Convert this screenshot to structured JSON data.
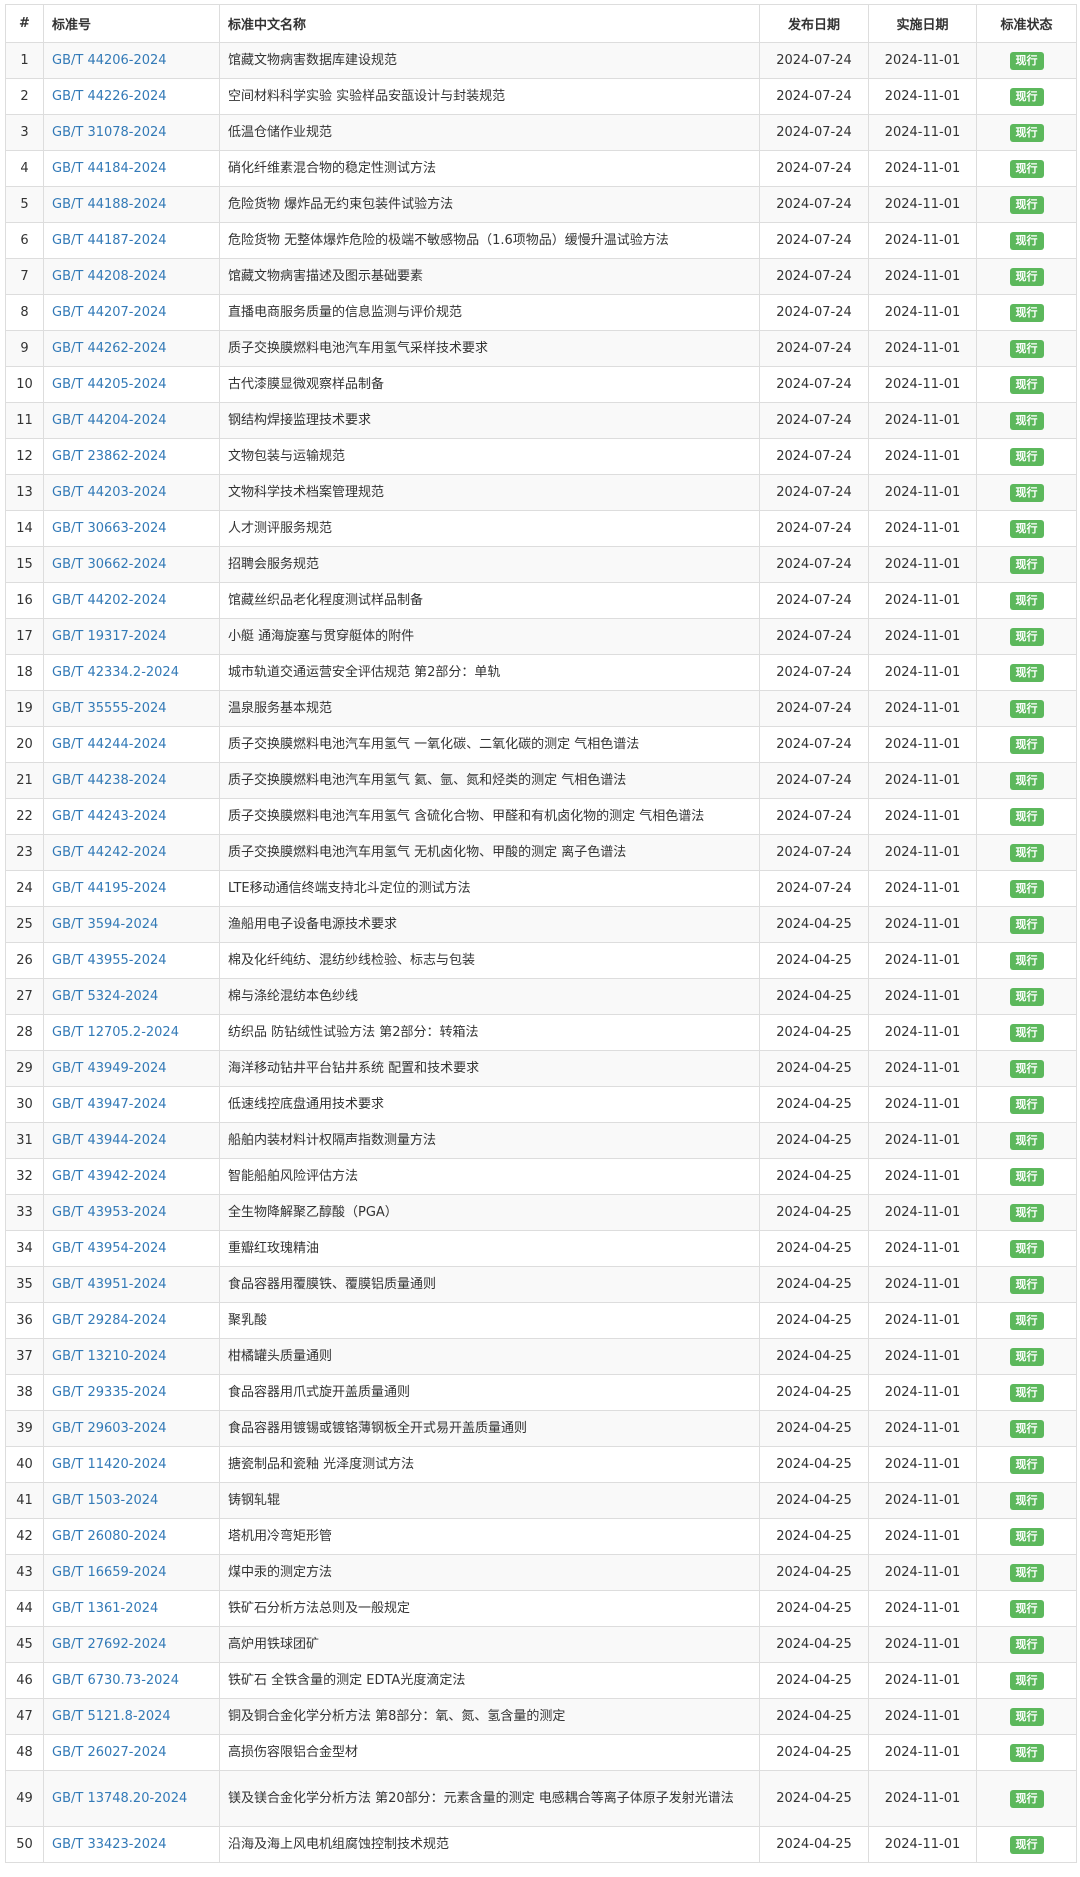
{
  "header": {
    "index": "#",
    "code": "标准号",
    "name": "标准中文名称",
    "published": "发布日期",
    "effective": "实施日期",
    "status": "标准状态"
  },
  "rows": [
    {
      "n": "1",
      "code": "GB/T 44206-2024",
      "name": "馆藏文物病害数据库建设规范",
      "pub": "2024-07-24",
      "eff": "2024-11-01",
      "status": "现行"
    },
    {
      "n": "2",
      "code": "GB/T 44226-2024",
      "name": "空间材料科学实验 实验样品安瓿设计与封装规范",
      "pub": "2024-07-24",
      "eff": "2024-11-01",
      "status": "现行"
    },
    {
      "n": "3",
      "code": "GB/T 31078-2024",
      "name": "低温仓储作业规范",
      "pub": "2024-07-24",
      "eff": "2024-11-01",
      "status": "现行"
    },
    {
      "n": "4",
      "code": "GB/T 44184-2024",
      "name": "硝化纤维素混合物的稳定性测试方法",
      "pub": "2024-07-24",
      "eff": "2024-11-01",
      "status": "现行"
    },
    {
      "n": "5",
      "code": "GB/T 44188-2024",
      "name": "危险货物 爆炸品无约束包装件试验方法",
      "pub": "2024-07-24",
      "eff": "2024-11-01",
      "status": "现行"
    },
    {
      "n": "6",
      "code": "GB/T 44187-2024",
      "name": "危险货物 无整体爆炸危险的极端不敏感物品（1.6项物品）缓慢升温试验方法",
      "pub": "2024-07-24",
      "eff": "2024-11-01",
      "status": "现行"
    },
    {
      "n": "7",
      "code": "GB/T 44208-2024",
      "name": "馆藏文物病害描述及图示基础要素",
      "pub": "2024-07-24",
      "eff": "2024-11-01",
      "status": "现行"
    },
    {
      "n": "8",
      "code": "GB/T 44207-2024",
      "name": "直播电商服务质量的信息监测与评价规范",
      "pub": "2024-07-24",
      "eff": "2024-11-01",
      "status": "现行"
    },
    {
      "n": "9",
      "code": "GB/T 44262-2024",
      "name": "质子交换膜燃料电池汽车用氢气采样技术要求",
      "pub": "2024-07-24",
      "eff": "2024-11-01",
      "status": "现行"
    },
    {
      "n": "10",
      "code": "GB/T 44205-2024",
      "name": "古代漆膜显微观察样品制备",
      "pub": "2024-07-24",
      "eff": "2024-11-01",
      "status": "现行"
    },
    {
      "n": "11",
      "code": "GB/T 44204-2024",
      "name": "钢结构焊接监理技术要求",
      "pub": "2024-07-24",
      "eff": "2024-11-01",
      "status": "现行"
    },
    {
      "n": "12",
      "code": "GB/T 23862-2024",
      "name": "文物包装与运输规范",
      "pub": "2024-07-24",
      "eff": "2024-11-01",
      "status": "现行"
    },
    {
      "n": "13",
      "code": "GB/T 44203-2024",
      "name": "文物科学技术档案管理规范",
      "pub": "2024-07-24",
      "eff": "2024-11-01",
      "status": "现行"
    },
    {
      "n": "14",
      "code": "GB/T 30663-2024",
      "name": "人才测评服务规范",
      "pub": "2024-07-24",
      "eff": "2024-11-01",
      "status": "现行"
    },
    {
      "n": "15",
      "code": "GB/T 30662-2024",
      "name": "招聘会服务规范",
      "pub": "2024-07-24",
      "eff": "2024-11-01",
      "status": "现行"
    },
    {
      "n": "16",
      "code": "GB/T 44202-2024",
      "name": "馆藏丝织品老化程度测试样品制备",
      "pub": "2024-07-24",
      "eff": "2024-11-01",
      "status": "现行"
    },
    {
      "n": "17",
      "code": "GB/T 19317-2024",
      "name": "小艇 通海旋塞与贯穿艇体的附件",
      "pub": "2024-07-24",
      "eff": "2024-11-01",
      "status": "现行"
    },
    {
      "n": "18",
      "code": "GB/T 42334.2-2024",
      "name": "城市轨道交通运营安全评估规范 第2部分：单轨",
      "pub": "2024-07-24",
      "eff": "2024-11-01",
      "status": "现行"
    },
    {
      "n": "19",
      "code": "GB/T 35555-2024",
      "name": "温泉服务基本规范",
      "pub": "2024-07-24",
      "eff": "2024-11-01",
      "status": "现行"
    },
    {
      "n": "20",
      "code": "GB/T 44244-2024",
      "name": "质子交换膜燃料电池汽车用氢气 一氧化碳、二氧化碳的测定 气相色谱法",
      "pub": "2024-07-24",
      "eff": "2024-11-01",
      "status": "现行"
    },
    {
      "n": "21",
      "code": "GB/T 44238-2024",
      "name": "质子交换膜燃料电池汽车用氢气 氦、氩、氮和烃类的测定 气相色谱法",
      "pub": "2024-07-24",
      "eff": "2024-11-01",
      "status": "现行"
    },
    {
      "n": "22",
      "code": "GB/T 44243-2024",
      "name": "质子交换膜燃料电池汽车用氢气 含硫化合物、甲醛和有机卤化物的测定 气相色谱法",
      "pub": "2024-07-24",
      "eff": "2024-11-01",
      "status": "现行"
    },
    {
      "n": "23",
      "code": "GB/T 44242-2024",
      "name": "质子交换膜燃料电池汽车用氢气 无机卤化物、甲酸的测定 离子色谱法",
      "pub": "2024-07-24",
      "eff": "2024-11-01",
      "status": "现行"
    },
    {
      "n": "24",
      "code": "GB/T 44195-2024",
      "name": "LTE移动通信终端支持北斗定位的测试方法",
      "pub": "2024-07-24",
      "eff": "2024-11-01",
      "status": "现行"
    },
    {
      "n": "25",
      "code": "GB/T 3594-2024",
      "name": "渔船用电子设备电源技术要求",
      "pub": "2024-04-25",
      "eff": "2024-11-01",
      "status": "现行"
    },
    {
      "n": "26",
      "code": "GB/T 43955-2024",
      "name": "棉及化纤纯纺、混纺纱线检验、标志与包装",
      "pub": "2024-04-25",
      "eff": "2024-11-01",
      "status": "现行"
    },
    {
      "n": "27",
      "code": "GB/T 5324-2024",
      "name": "棉与涤纶混纺本色纱线",
      "pub": "2024-04-25",
      "eff": "2024-11-01",
      "status": "现行"
    },
    {
      "n": "28",
      "code": "GB/T 12705.2-2024",
      "name": "纺织品 防钻绒性试验方法 第2部分：转箱法",
      "pub": "2024-04-25",
      "eff": "2024-11-01",
      "status": "现行"
    },
    {
      "n": "29",
      "code": "GB/T 43949-2024",
      "name": "海洋移动钻井平台钻井系统 配置和技术要求",
      "pub": "2024-04-25",
      "eff": "2024-11-01",
      "status": "现行"
    },
    {
      "n": "30",
      "code": "GB/T 43947-2024",
      "name": "低速线控底盘通用技术要求",
      "pub": "2024-04-25",
      "eff": "2024-11-01",
      "status": "现行"
    },
    {
      "n": "31",
      "code": "GB/T 43944-2024",
      "name": "船舶内装材料计权隔声指数测量方法",
      "pub": "2024-04-25",
      "eff": "2024-11-01",
      "status": "现行"
    },
    {
      "n": "32",
      "code": "GB/T 43942-2024",
      "name": "智能船舶风险评估方法",
      "pub": "2024-04-25",
      "eff": "2024-11-01",
      "status": "现行"
    },
    {
      "n": "33",
      "code": "GB/T 43953-2024",
      "name": "全生物降解聚乙醇酸（PGA）",
      "pub": "2024-04-25",
      "eff": "2024-11-01",
      "status": "现行"
    },
    {
      "n": "34",
      "code": "GB/T 43954-2024",
      "name": "重瓣红玫瑰精油",
      "pub": "2024-04-25",
      "eff": "2024-11-01",
      "status": "现行"
    },
    {
      "n": "35",
      "code": "GB/T 43951-2024",
      "name": "食品容器用覆膜铁、覆膜铝质量通则",
      "pub": "2024-04-25",
      "eff": "2024-11-01",
      "status": "现行"
    },
    {
      "n": "36",
      "code": "GB/T 29284-2024",
      "name": "聚乳酸",
      "pub": "2024-04-25",
      "eff": "2024-11-01",
      "status": "现行"
    },
    {
      "n": "37",
      "code": "GB/T 13210-2024",
      "name": "柑橘罐头质量通则",
      "pub": "2024-04-25",
      "eff": "2024-11-01",
      "status": "现行"
    },
    {
      "n": "38",
      "code": "GB/T 29335-2024",
      "name": "食品容器用爪式旋开盖质量通则",
      "pub": "2024-04-25",
      "eff": "2024-11-01",
      "status": "现行"
    },
    {
      "n": "39",
      "code": "GB/T 29603-2024",
      "name": "食品容器用镀锡或镀铬薄钢板全开式易开盖质量通则",
      "pub": "2024-04-25",
      "eff": "2024-11-01",
      "status": "现行"
    },
    {
      "n": "40",
      "code": "GB/T 11420-2024",
      "name": "搪瓷制品和瓷釉 光泽度测试方法",
      "pub": "2024-04-25",
      "eff": "2024-11-01",
      "status": "现行"
    },
    {
      "n": "41",
      "code": "GB/T 1503-2024",
      "name": "铸钢轧辊",
      "pub": "2024-04-25",
      "eff": "2024-11-01",
      "status": "现行"
    },
    {
      "n": "42",
      "code": "GB/T 26080-2024",
      "name": "塔机用冷弯矩形管",
      "pub": "2024-04-25",
      "eff": "2024-11-01",
      "status": "现行"
    },
    {
      "n": "43",
      "code": "GB/T 16659-2024",
      "name": "煤中汞的测定方法",
      "pub": "2024-04-25",
      "eff": "2024-11-01",
      "status": "现行"
    },
    {
      "n": "44",
      "code": "GB/T 1361-2024",
      "name": "铁矿石分析方法总则及一般规定",
      "pub": "2024-04-25",
      "eff": "2024-11-01",
      "status": "现行"
    },
    {
      "n": "45",
      "code": "GB/T 27692-2024",
      "name": "高炉用铁球团矿",
      "pub": "2024-04-25",
      "eff": "2024-11-01",
      "status": "现行"
    },
    {
      "n": "46",
      "code": "GB/T 6730.73-2024",
      "name": "铁矿石 全铁含量的测定 EDTA光度滴定法",
      "pub": "2024-04-25",
      "eff": "2024-11-01",
      "status": "现行"
    },
    {
      "n": "47",
      "code": "GB/T 5121.8-2024",
      "name": "铜及铜合金化学分析方法 第8部分：氧、氮、氢含量的测定",
      "pub": "2024-04-25",
      "eff": "2024-11-01",
      "status": "现行"
    },
    {
      "n": "48",
      "code": "GB/T 26027-2024",
      "name": "高损伤容限铝合金型材",
      "pub": "2024-04-25",
      "eff": "2024-11-01",
      "status": "现行"
    },
    {
      "n": "49",
      "code": "GB/T 13748.20-2024",
      "name": "镁及镁合金化学分析方法 第20部分：元素含量的测定 电感耦合等离子体原子发射光谱法",
      "pub": "2024-04-25",
      "eff": "2024-11-01",
      "status": "现行",
      "tall": true
    },
    {
      "n": "50",
      "code": "GB/T 33423-2024",
      "name": "沿海及海上风电机组腐蚀控制技术规范",
      "pub": "2024-04-25",
      "eff": "2024-11-01",
      "status": "现行"
    }
  ],
  "colors": {
    "link": "#337ab7",
    "status_badge": "#5cb85c",
    "row_stripe": "#f9f9f9",
    "border": "#dddddd"
  }
}
